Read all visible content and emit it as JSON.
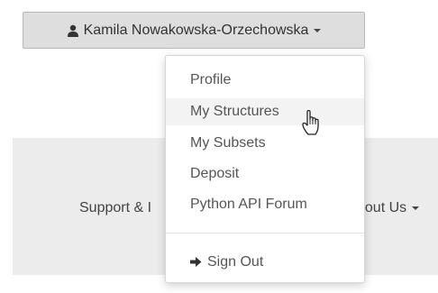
{
  "user_menu": {
    "username": "Kamila Nowakowska-Orzechowska",
    "icon": "user-icon"
  },
  "dropdown": {
    "items": [
      {
        "label": "Profile"
      },
      {
        "label": "My Structures",
        "hovered": true
      },
      {
        "label": "My Subsets"
      },
      {
        "label": "Deposit"
      },
      {
        "label": "Python API Forum"
      }
    ],
    "sign_out": {
      "label": "Sign Out",
      "icon": "sign-out-icon"
    }
  },
  "footer_nav": {
    "support_label": "Support & I",
    "about_label": "bout Us"
  }
}
